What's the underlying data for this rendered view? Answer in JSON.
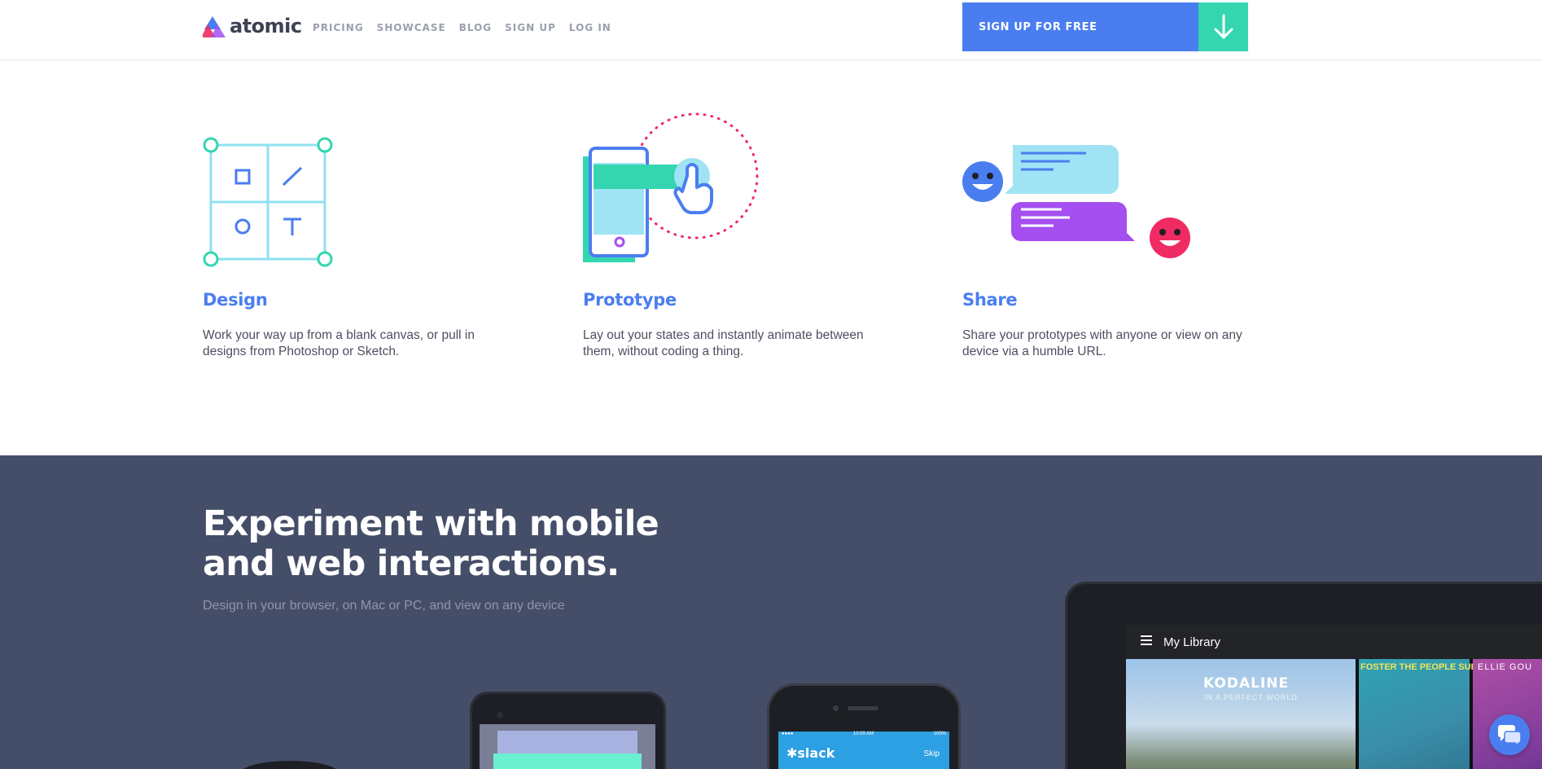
{
  "header": {
    "logo_text": "atomic",
    "nav": [
      "PRICING",
      "SHOWCASE",
      "BLOG",
      "SIGN UP",
      "LOG IN"
    ],
    "cta_label": "SIGN UP FOR FREE"
  },
  "features": [
    {
      "title": "Design",
      "description": "Work your way up from a blank canvas, or pull in designs from Photoshop or Sketch."
    },
    {
      "title": "Prototype",
      "description": "Lay out your states and instantly animate between them, without coding a thing."
    },
    {
      "title": "Share",
      "description": "Share your prototypes with anyone or view on any device via a humble URL."
    }
  ],
  "showcase": {
    "headline_line1": "Experiment with mobile",
    "headline_line2": "and web interactions.",
    "subline": "Design in your browser, on Mac or PC, and view on any device",
    "tablet": {
      "library_title": "My Library",
      "albums": [
        {
          "title": "KODALINE",
          "subtitle": "IN A PERFECT WORLD"
        },
        {
          "title": "FOSTER THE PEOPLE SUPERMODEL"
        },
        {
          "title": "ELLIE GOU"
        }
      ]
    },
    "iphone": {
      "time": "10:00 AM",
      "battery": "100%",
      "app": "slack",
      "skip_label": "Skip"
    }
  },
  "colors": {
    "accent_blue": "#4a7ef0",
    "accent_green": "#34d6b0",
    "dark_section": "#454e68",
    "pink": "#f02b63",
    "purple": "#a54ff0"
  },
  "icons": [
    "atomic-logo-icon",
    "arrow-down-icon",
    "menu-icon",
    "chat-icon"
  ]
}
